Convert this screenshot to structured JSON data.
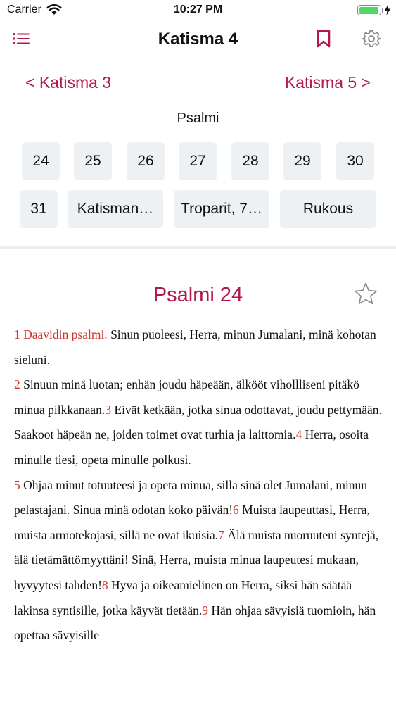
{
  "status_bar": {
    "carrier": "Carrier",
    "time": "10:27 PM",
    "battery_level": 0.95,
    "battery_color": "#4cd964"
  },
  "nav": {
    "title": "Katisma 4",
    "accent_color": "#b3174f",
    "icons": [
      "list-icon",
      "bookmark-icon",
      "gear-icon"
    ]
  },
  "katisma_nav": {
    "prev": "< Katisma 3",
    "next": "Katisma 5 >"
  },
  "section_label": "Psalmi",
  "psalm_buttons": [
    {
      "label": "24"
    },
    {
      "label": "25"
    },
    {
      "label": "26"
    },
    {
      "label": "27"
    },
    {
      "label": "28"
    },
    {
      "label": "29"
    },
    {
      "label": "30"
    },
    {
      "label": "31"
    },
    {
      "label": "Katisman…"
    },
    {
      "label": "Troparit, 7…"
    },
    {
      "label": "Rukous"
    }
  ],
  "content": {
    "title": "Psalmi 24",
    "verse_number_color": "#d0342c",
    "verses": [
      {
        "num": "1",
        "text": "Daavidin psalmi.",
        "highlight": true
      },
      {
        "num": "",
        "text": " Sinun puoleesi, Herra, minun Jumalani, minä kohotan sieluni."
      },
      {
        "num": "2",
        "text": " Sinuun minä luotan; enhän joudu häpeään, älkööt vihollliseni pitäkö minua pilkkanaan."
      },
      {
        "num": "3",
        "text": " Eivät ketkään, jotka sinua odottavat, joudu pettymään. Saakoot häpeän ne, joiden toimet ovat turhia ja laittomia."
      },
      {
        "num": "4",
        "text": " Herra, osoita minulle tiesi, opeta minulle polkusi."
      },
      {
        "num": "5",
        "text": " Ohjaa minut totuuteesi ja opeta minua, sillä sinä olet Jumalani, minun pelastajani. Sinua minä odotan koko päivän!"
      },
      {
        "num": "6",
        "text": " Muista laupeuttasi, Herra, muista armotekojasi, sillä ne ovat ikuisia."
      },
      {
        "num": "7",
        "text": " Älä muista nuoruuteni syntejä, älä tietämättömyyttäni! Sinä, Herra, muista minua laupeutesi mukaan, hyvyytesi tähden!"
      },
      {
        "num": "8",
        "text": " Hyvä ja oikeamielinen on Herra, siksi hän säätää lakinsa syntisille, jotka käyvät tietään."
      },
      {
        "num": "9",
        "text": " Hän ohjaa sävyisiä tuomioin, hän opettaa sävyisille"
      }
    ]
  }
}
